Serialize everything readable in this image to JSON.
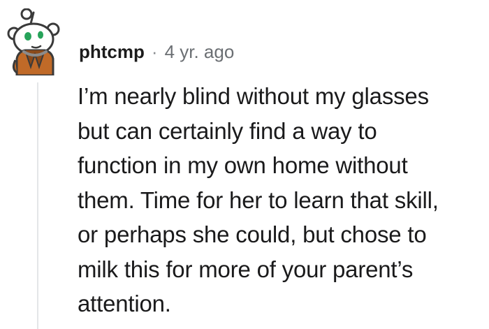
{
  "comment": {
    "username": "phtcmp",
    "separator": "·",
    "timestamp": "4 yr. ago",
    "text_lines": [
      "I’m nearly blind without my glasses",
      "but can certainly find a way to",
      "function in my own home without",
      "them. Time for her to learn that skill,",
      "or perhaps she could, but chose to",
      "milk this for more of your parent’s",
      "attention."
    ],
    "avatar_icon": "snoo-avatar-icon",
    "colors": {
      "username": "#1c1c1c",
      "muted": "#6b6f73",
      "thread_line": "#e4e6e8",
      "body": "#1a1a1b"
    }
  }
}
